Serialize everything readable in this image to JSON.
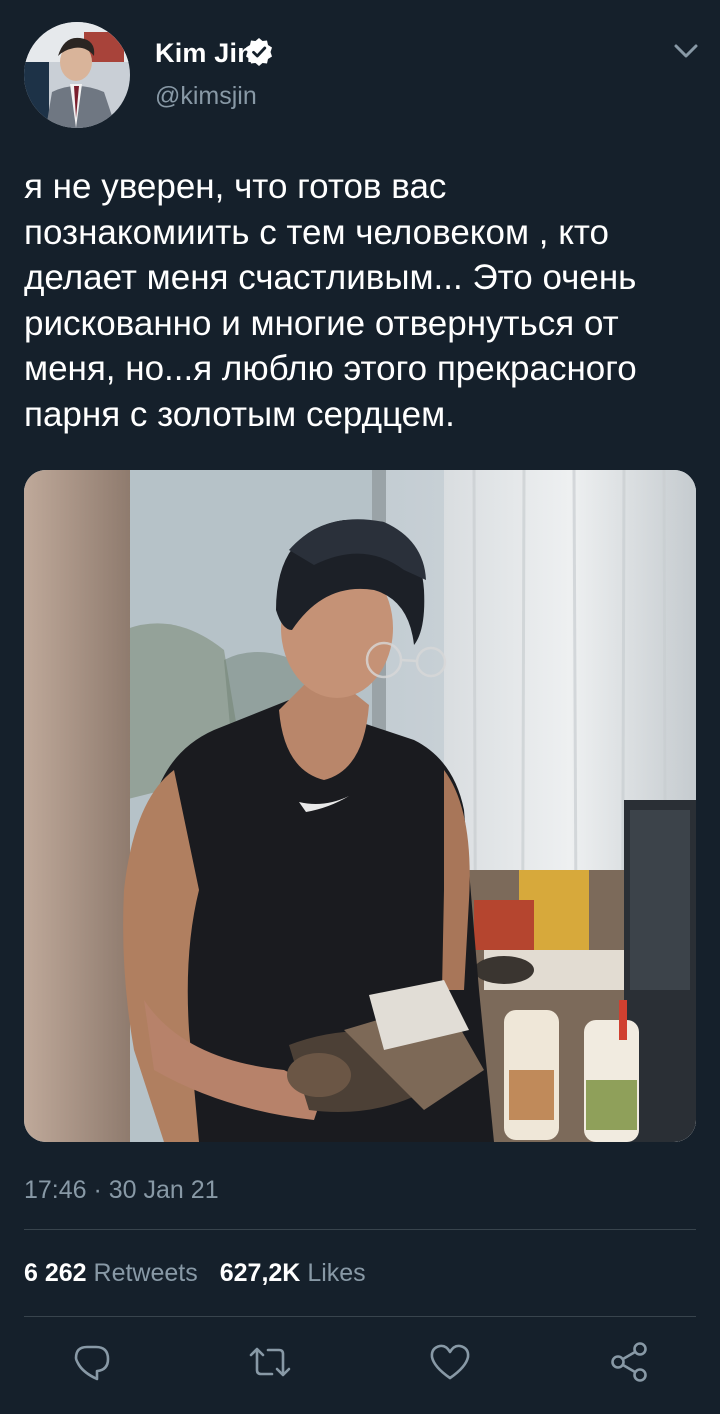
{
  "author": {
    "display_name": "Kim Jin",
    "handle": "@kimsjin",
    "verified": true,
    "avatar_icon": "profile-photo"
  },
  "tweet": {
    "text": "я не уверен, что готов вас познакомиить с тем человеком , кто делает меня счастливым... Это очень рискованно и многие отвернуться от меня, но...я люблю этого прекрасного парня с золотым сердцем.",
    "lines": [
      "я не уверен, что готов вас",
      "познакомиить с тем человеком , кто",
      "делает меня счастливым... Это очень",
      "рискованно и многие отвернуться от",
      "меня, но...я люблю этого прекрасного",
      "парня с золотым сердцем."
    ],
    "timestamp": "17:46 · 30 Jan 21",
    "media_icon": "photo-man-in-kitchen"
  },
  "stats": {
    "retweets_count": "6 262",
    "retweets_label": "Retweets",
    "likes_count": "627,2K",
    "likes_label": "Likes"
  },
  "actions": {
    "reply_icon": "reply-icon",
    "retweet_icon": "retweet-icon",
    "like_icon": "heart-icon",
    "share_icon": "share-icon"
  },
  "colors": {
    "background": "#15202b",
    "secondary_text": "#8899a6",
    "divider": "#38444d",
    "verified_badge": "#ffffff"
  }
}
